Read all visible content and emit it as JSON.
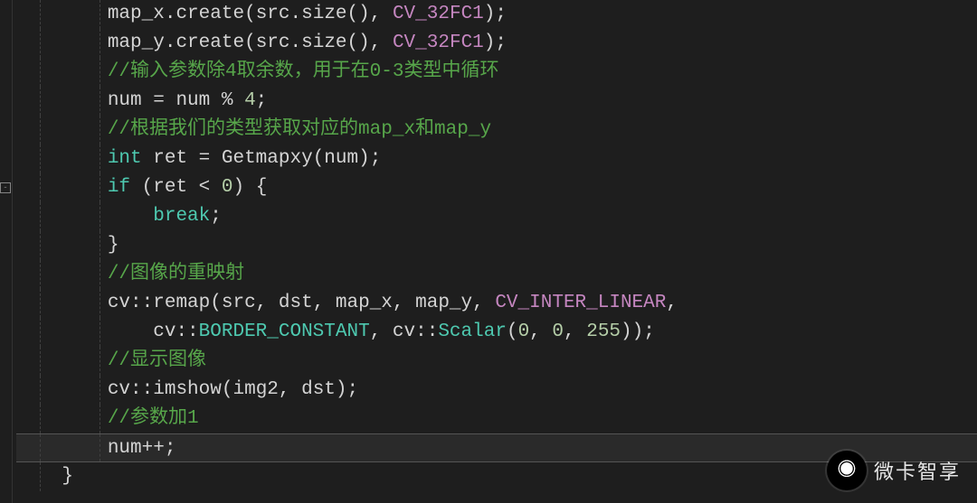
{
  "watermark": {
    "text": "微卡智享"
  },
  "code": {
    "lines": [
      {
        "indent": 2,
        "tokens": [
          {
            "t": "default",
            "v": "map_x."
          },
          {
            "t": "func",
            "v": "create"
          },
          {
            "t": "punct",
            "v": "("
          },
          {
            "t": "default",
            "v": "src."
          },
          {
            "t": "func",
            "v": "size"
          },
          {
            "t": "punct",
            "v": "(), "
          },
          {
            "t": "const",
            "v": "CV_32FC1"
          },
          {
            "t": "punct",
            "v": ");"
          }
        ]
      },
      {
        "indent": 2,
        "tokens": [
          {
            "t": "default",
            "v": "map_y."
          },
          {
            "t": "func",
            "v": "create"
          },
          {
            "t": "punct",
            "v": "("
          },
          {
            "t": "default",
            "v": "src."
          },
          {
            "t": "func",
            "v": "size"
          },
          {
            "t": "punct",
            "v": "(), "
          },
          {
            "t": "const",
            "v": "CV_32FC1"
          },
          {
            "t": "punct",
            "v": ");"
          }
        ]
      },
      {
        "indent": 2,
        "tokens": [
          {
            "t": "comment",
            "v": "//输入参数除4取余数，用于在0-3类型中循环"
          }
        ]
      },
      {
        "indent": 2,
        "tokens": [
          {
            "t": "default",
            "v": "num = num % "
          },
          {
            "t": "number",
            "v": "4"
          },
          {
            "t": "punct",
            "v": ";"
          }
        ]
      },
      {
        "indent": 2,
        "tokens": [
          {
            "t": "comment",
            "v": "//根据我们的类型获取对应的map_x和map_y"
          }
        ]
      },
      {
        "indent": 2,
        "tokens": [
          {
            "t": "keyword",
            "v": "int"
          },
          {
            "t": "default",
            "v": " ret = "
          },
          {
            "t": "func",
            "v": "Getmapxy"
          },
          {
            "t": "punct",
            "v": "("
          },
          {
            "t": "default",
            "v": "num"
          },
          {
            "t": "punct",
            "v": ");"
          }
        ]
      },
      {
        "indent": 2,
        "tokens": [
          {
            "t": "keyword",
            "v": "if"
          },
          {
            "t": "default",
            "v": " "
          },
          {
            "t": "punct",
            "v": "("
          },
          {
            "t": "default",
            "v": "ret < "
          },
          {
            "t": "number",
            "v": "0"
          },
          {
            "t": "punct",
            "v": ") {"
          }
        ]
      },
      {
        "indent": 3,
        "tokens": [
          {
            "t": "keyword",
            "v": "break"
          },
          {
            "t": "punct",
            "v": ";"
          }
        ]
      },
      {
        "indent": 2,
        "tokens": [
          {
            "t": "punct",
            "v": "}"
          }
        ]
      },
      {
        "indent": 2,
        "tokens": [
          {
            "t": "comment",
            "v": "//图像的重映射"
          }
        ]
      },
      {
        "indent": 2,
        "tokens": [
          {
            "t": "default",
            "v": "cv::"
          },
          {
            "t": "func",
            "v": "remap"
          },
          {
            "t": "punct",
            "v": "("
          },
          {
            "t": "default",
            "v": "src, dst, map_x, map_y, "
          },
          {
            "t": "macro",
            "v": "CV_INTER_LINEAR"
          },
          {
            "t": "punct",
            "v": ","
          }
        ]
      },
      {
        "indent": 3,
        "tokens": [
          {
            "t": "default",
            "v": "cv::"
          },
          {
            "t": "member",
            "v": "BORDER_CONSTANT"
          },
          {
            "t": "punct",
            "v": ", "
          },
          {
            "t": "default",
            "v": "cv::"
          },
          {
            "t": "call",
            "v": "Scalar"
          },
          {
            "t": "punct",
            "v": "("
          },
          {
            "t": "number",
            "v": "0"
          },
          {
            "t": "punct",
            "v": ", "
          },
          {
            "t": "number",
            "v": "0"
          },
          {
            "t": "punct",
            "v": ", "
          },
          {
            "t": "number",
            "v": "255"
          },
          {
            "t": "punct",
            "v": "));"
          }
        ]
      },
      {
        "indent": 2,
        "tokens": [
          {
            "t": "comment",
            "v": "//显示图像"
          }
        ]
      },
      {
        "indent": 2,
        "tokens": [
          {
            "t": "default",
            "v": "cv::"
          },
          {
            "t": "func",
            "v": "imshow"
          },
          {
            "t": "punct",
            "v": "("
          },
          {
            "t": "default",
            "v": "img2, dst"
          },
          {
            "t": "punct",
            "v": ");"
          }
        ]
      },
      {
        "indent": 2,
        "tokens": [
          {
            "t": "comment",
            "v": "//参数加1"
          }
        ]
      },
      {
        "indent": 2,
        "highlight": true,
        "tokens": [
          {
            "t": "default",
            "v": "num++"
          },
          {
            "t": "punct",
            "v": ";"
          }
        ]
      },
      {
        "indent": 1,
        "tokens": [
          {
            "t": "punct",
            "v": "}"
          }
        ]
      }
    ]
  }
}
